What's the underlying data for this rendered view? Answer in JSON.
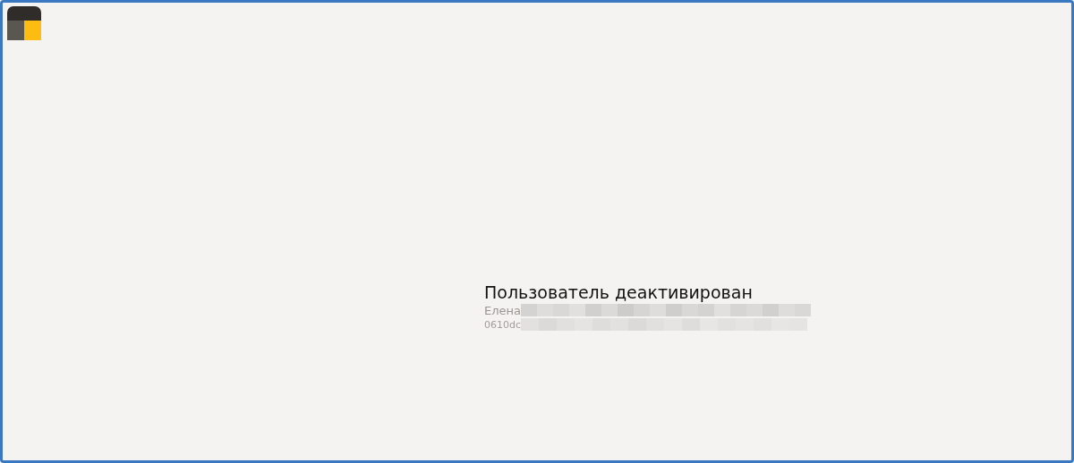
{
  "title": "Пользователь деактивирован",
  "name": "Елена",
  "id": "0610dc"
}
